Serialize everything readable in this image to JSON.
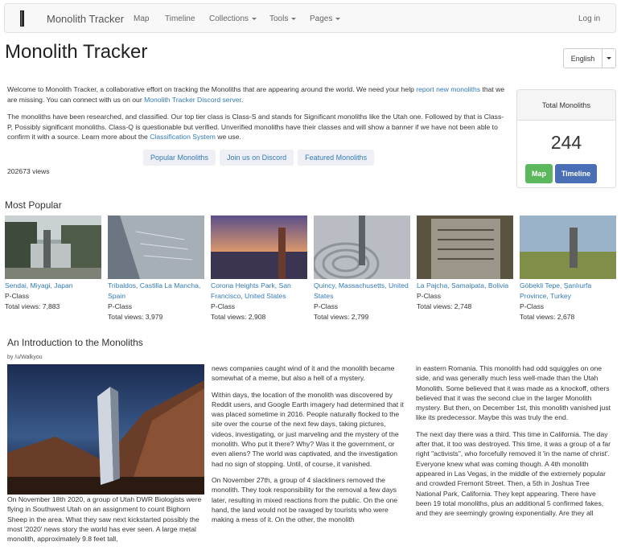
{
  "nav": {
    "brand": "Monolith Tracker",
    "items": [
      {
        "label": "Map",
        "dropdown": false
      },
      {
        "label": "Timeline",
        "dropdown": false
      },
      {
        "label": "Collections",
        "dropdown": true
      },
      {
        "label": "Tools",
        "dropdown": true
      },
      {
        "label": "Pages",
        "dropdown": true
      }
    ],
    "login": "Log in"
  },
  "header": {
    "title": "Monolith Tracker",
    "language": "English"
  },
  "intro": {
    "p1_a": "Welcome to Monolith Tracker, a collaborative effort on tracking the Monoliths that are appearing around the world. We need your help ",
    "p1_link1": "report new monoliths",
    "p1_b": " that we are missing. You can connect with us on our ",
    "p1_link2": "Monolith Tracker Discord server",
    "p1_c": ".",
    "p2_a": "The monoliths have been researched, and classified. Our top tier class is Class-S and stands for Significant monoliths like the Utah one. Followed by that is Class-P, Possibly significant monoliths. Class-Q is questionable but verified. Unverified monoliths have their classes and will show a banner if we have not been able to confirm it with a source. Learn more about the ",
    "p2_link": "Classification System",
    "p2_b": " we use.",
    "pills": [
      "Popular Monoliths",
      "Join us on Discord",
      "Featured Monoliths"
    ],
    "views": "202673 views"
  },
  "total": {
    "label": "Total Monoliths",
    "count": "244",
    "map_btn": "Map",
    "timeline_btn": "Timeline"
  },
  "popular": {
    "title": "Most Popular",
    "cards": [
      {
        "name": "Sendai, Miyagi, Japan",
        "class": "P-Class",
        "views": "Total views: 7,883"
      },
      {
        "name": "Tribaldos, Castilla La Mancha, Spain",
        "class": "P-Class",
        "views": "Total views: 3,979"
      },
      {
        "name": "Corona Heights Park, San Francisco, United States",
        "class": "P-Class",
        "views": "Total views: 2,908"
      },
      {
        "name": "Quincy, Massachusetts, United States",
        "class": "P-Class",
        "views": "Total views: 2,799"
      },
      {
        "name": "La Pajcha, Samaipata, Bolivia",
        "class": "P-Class",
        "views": "Total views: 2,748"
      },
      {
        "name": "Göbekli Tepe, Şanlıurfa Province, Turkey",
        "class": "P-Class",
        "views": "Total views: 2,678"
      }
    ]
  },
  "article": {
    "title": "An Introduction to the Monoliths",
    "byline": "by /u/Walkyou",
    "col1": "On November 18th 2020, a group of Utah DWR Biologists were flying in Southwest Utah on an assignment to count Bighorn Sheep in the area. What they saw next kickstarted possibly the most '2020' news story the world has ever seen. A large metal monolith, approximately 9.8 feet tall,",
    "col2_p1": "news companies caught wind of it and the monolith became somewhat of a meme, but also a hell of a mystery.",
    "col2_p2": "Within days, the location of the monolith was discovered by Reddit users, and Google Earth imagery had determined that it was placed sometime in 2016. People naturally flocked to the site over the course of the next few days, taking pictures, videos, investigating, or just marveling and the mystery of the monolith. Who put it there? Why? Was it the government, or even aliens? The world was captivated, and the investigation had no sign of stopping. Until, of course, it vanished.",
    "col2_p3": "On November 27th, a group of 4 slackliners removed the monolith. They took responsibility for the removal a few days later, resulting in mixed reactions from the public. On the one hand, the land would not be ravaged by tourists who were making a mess of it. On the other, the monolith",
    "col3_p1": "in eastern Romania. This monolith had odd squiggles on one side, and was generally much less well-made than the Utah Monolith. Some believed that it was made as a knockoff, others believed that it was the second clue in the larger Monolith mystery. But then, on December 1st, this monolith vanished just like its predecessor. Maybe this was truly the end.",
    "col3_p2": "The next day there was a third. This time in California. The day after that, it too was destroyed. This time, it was a group of a far right \"activists\", who forcefully removed it 'in the name of christ'. Everyone knew what was coming though. A 4th monolith appeared in Las Vegas, in the middle of the extremely popular and crowded Fremont Street. Then, a 5th in Joshua Tree National Park, California. They kept appearing. There have been 19 total monoliths, plus an additional 5 confirmed fakes, and they are seemingly growing exponentially. Are they all"
  }
}
